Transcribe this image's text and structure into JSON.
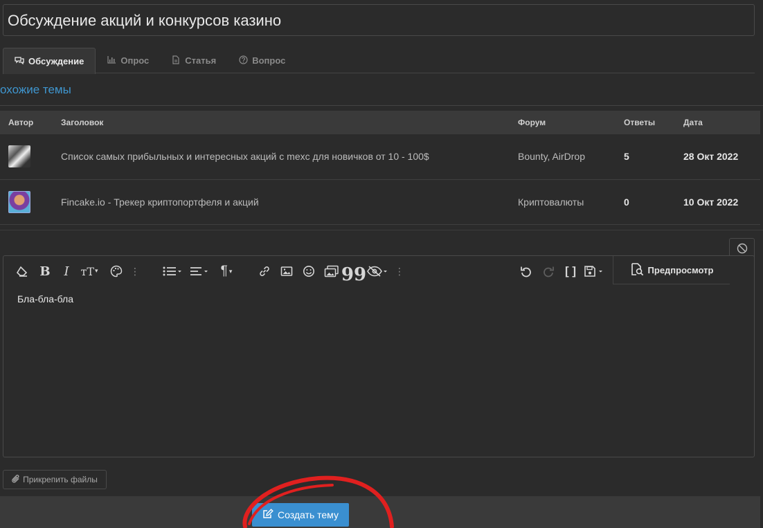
{
  "thread_title": "Обсуждение акций и конкурсов казино",
  "tabs": [
    {
      "label": "Обсуждение",
      "icon": "comments-icon",
      "active": true
    },
    {
      "label": "Опрос",
      "icon": "bar-chart-icon",
      "active": false
    },
    {
      "label": "Статья",
      "icon": "document-icon",
      "active": false
    },
    {
      "label": "Вопрос",
      "icon": "question-icon",
      "active": false
    }
  ],
  "similar": {
    "heading": "охожие темы",
    "columns": [
      "Автор",
      "Заголовок",
      "Форум",
      "Ответы",
      "Дата"
    ],
    "rows": [
      {
        "title": "Список самых прибыльных и интересных акций с mexc для новичков от 10 - 100$",
        "forum": "Bounty, AirDrop",
        "replies": "5",
        "date": "28 Окт 2022"
      },
      {
        "title": "Fincake.io - Трекер криптопортфеля и акций",
        "forum": "Криптовалюты",
        "replies": "0",
        "date": "10 Окт 2022"
      }
    ]
  },
  "editor": {
    "content": "Бла-бла-бла",
    "preview_label": "Предпросмотр"
  },
  "attach_label": "Прикрепить файлы",
  "create_label": "Создать тему",
  "colors": {
    "accent": "#3a8fd0",
    "link": "#3f96cf",
    "annotation": "#e0201f"
  }
}
